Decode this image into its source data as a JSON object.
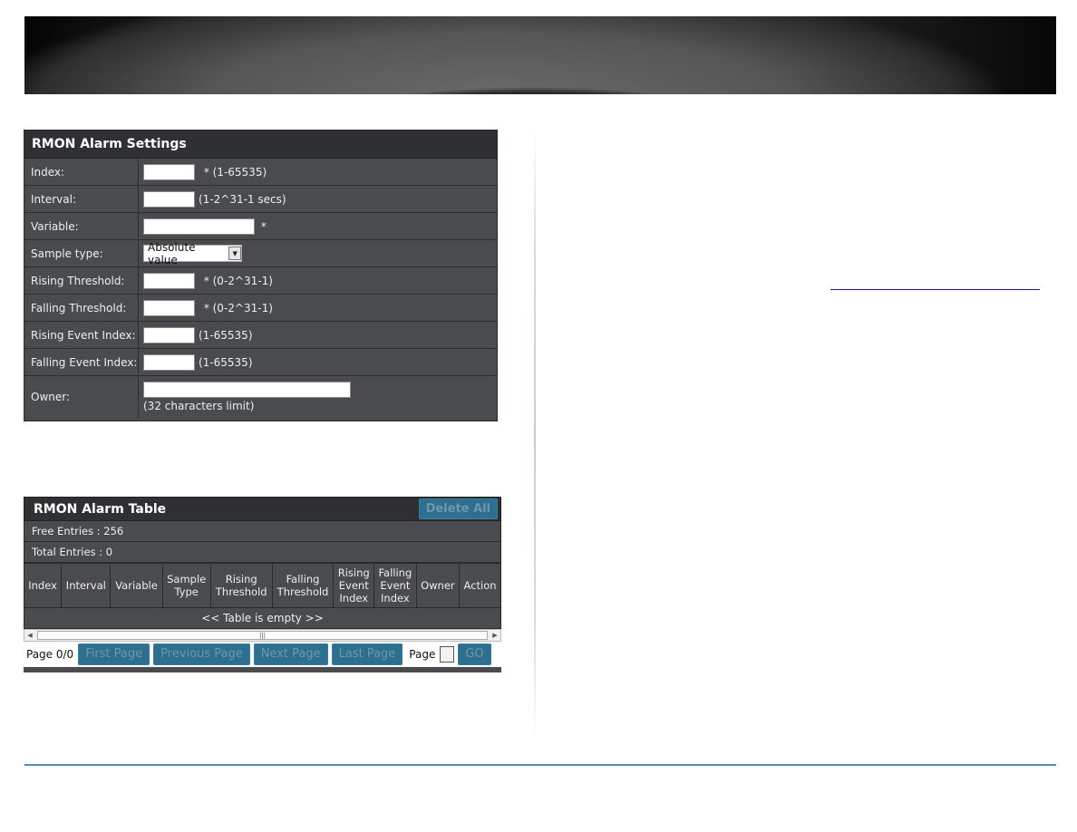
{
  "settings_panel": {
    "title": "RMON Alarm Settings",
    "fields": [
      {
        "label": "Index:",
        "value": "",
        "hint": " * (1-65535)"
      },
      {
        "label": "Interval:",
        "value": "",
        "hint": "(1-2^31-1 secs)"
      },
      {
        "label": "Variable:",
        "value": "",
        "hint": " *"
      },
      {
        "label": "Sample type:",
        "selected": "Absolute value"
      },
      {
        "label": "Rising Threshold:",
        "value": "",
        "hint": " * (0-2^31-1)"
      },
      {
        "label": "Falling Threshold:",
        "value": "",
        "hint": " * (0-2^31-1)"
      },
      {
        "label": "Rising Event Index:",
        "value": "",
        "hint": "(1-65535)"
      },
      {
        "label": "Falling Event Index:",
        "value": "",
        "hint": "(1-65535)"
      },
      {
        "label": "Owner:",
        "value": "",
        "hint": "(32 characters limit)"
      }
    ]
  },
  "table_panel": {
    "title": "RMON Alarm Table",
    "delete_all_label": "Delete All",
    "free_entries": "Free Entries : 256",
    "total_entries": "Total Entries : 0",
    "columns": [
      [
        "Index"
      ],
      [
        "Interval"
      ],
      [
        "Variable"
      ],
      [
        "Sample",
        "Type"
      ],
      [
        "Rising",
        "Threshold"
      ],
      [
        "Falling",
        "Threshold"
      ],
      [
        "Rising",
        "Event",
        "Index"
      ],
      [
        "Falling",
        "Event",
        "Index"
      ],
      [
        "Owner"
      ],
      [
        "Action"
      ]
    ],
    "empty_message": "<< Table is empty >>",
    "pager": {
      "page_status": "Page 0/0",
      "first_label": "First Page",
      "previous_label": "Previous Page",
      "next_label": "Next Page",
      "last_label": "Last Page",
      "page_label": "Page",
      "page_value": "",
      "go_label": "GO"
    }
  },
  "colors": {
    "panel_bg": "#4a4b4e",
    "title_bg": "#2f3033",
    "button_bg": "#2c6f8f",
    "footer_line": "#5b8ac4"
  }
}
